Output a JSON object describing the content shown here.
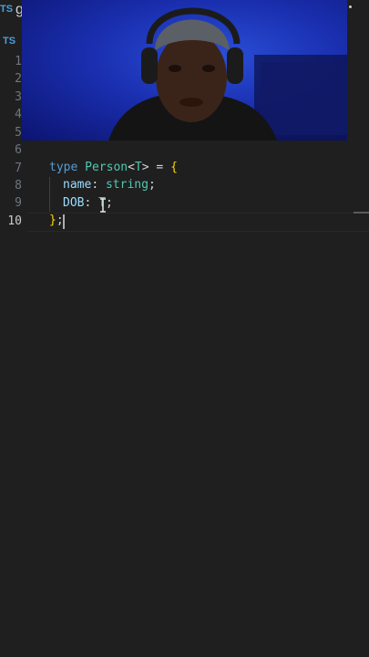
{
  "tab": {
    "icon_label": "TS",
    "file_name": "g"
  },
  "breadcrumb": {
    "icon_label": "TS"
  },
  "gutter": {
    "lines": [
      "1",
      "2",
      "3",
      "4",
      "5",
      "6",
      "7",
      "8",
      "9",
      "10"
    ],
    "active_line": "10"
  },
  "code": {
    "line7": {
      "kw": "type",
      "name": "Person",
      "lt": "<",
      "param": "T",
      "gt": ">",
      "eq": " = ",
      "open": "{"
    },
    "line8": {
      "prop": "name",
      "colon": ": ",
      "type": "string",
      "semi": ";"
    },
    "line9": {
      "prop": "DOB",
      "colon": ": ",
      "value": "T",
      "semi": ";"
    },
    "line10": {
      "close": "}",
      "semi": ";"
    }
  },
  "colors": {
    "keyword": "#569cd6",
    "type": "#4ec9b0",
    "property": "#9cdcfe",
    "bracket": "#ffd700",
    "editor_bg": "#1f1f1f"
  }
}
